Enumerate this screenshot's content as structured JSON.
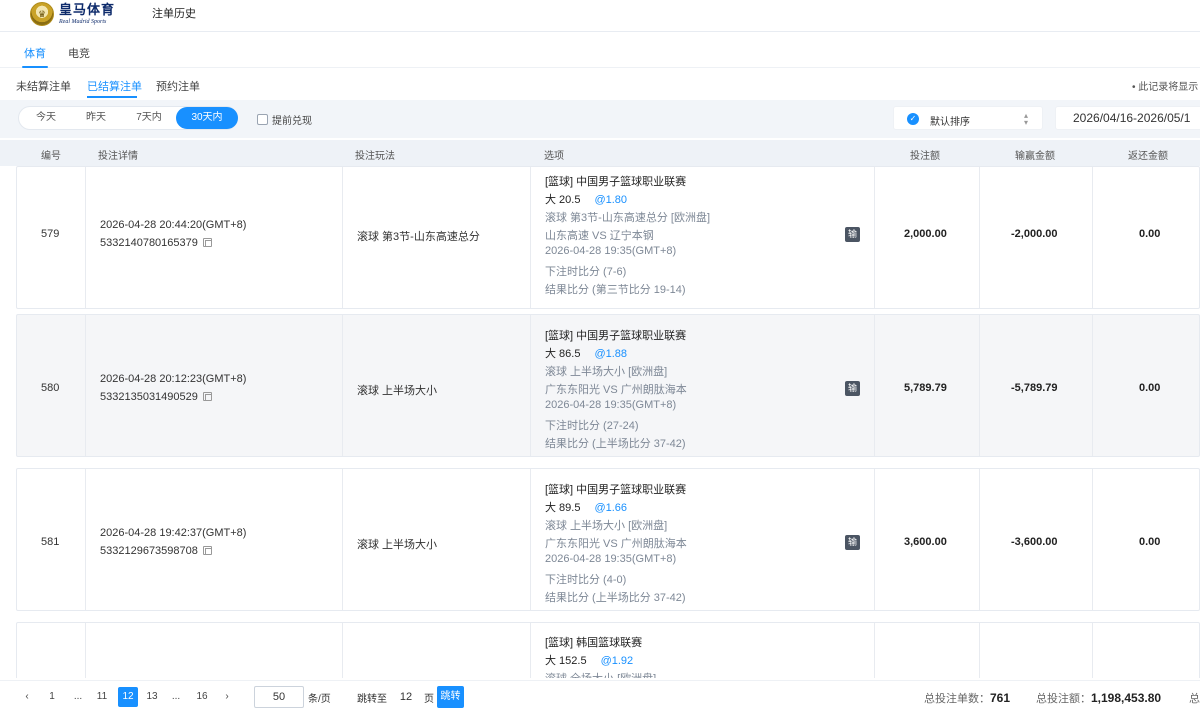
{
  "header": {
    "logo_cn": "皇马体育",
    "logo_en": "Real Madrid Sports",
    "page_title": "注单历史"
  },
  "top_tabs": [
    {
      "label": "体育",
      "active": true
    },
    {
      "label": "电竞",
      "active": false
    }
  ],
  "sub_tabs": [
    {
      "label": "未结算注单",
      "active": false
    },
    {
      "label": "已结算注单",
      "active": true
    },
    {
      "label": "预约注单",
      "active": false
    }
  ],
  "record_note": "• 此记录将显示",
  "filters": {
    "ranges": [
      {
        "label": "今天",
        "active": false
      },
      {
        "label": "昨天",
        "active": false
      },
      {
        "label": "7天内",
        "active": false
      },
      {
        "label": "30天内",
        "active": true
      }
    ],
    "early_cashout_label": "提前兑现",
    "early_cashout_checked": false,
    "sort_label": "默认排序",
    "date_range": "2026/04/16-2026/05/1"
  },
  "columns": [
    "编号",
    "投注详情",
    "投注玩法",
    "选项",
    "投注额",
    "输赢金额",
    "返还金额"
  ],
  "rows": [
    {
      "id": "579",
      "datetime": "2026-04-28 20:44:20(GMT+8)",
      "order_no": "5332140780165379",
      "play": "滚球   第3节-山东高速总分",
      "league": "[篮球] 中国男子篮球职业联赛",
      "pick": "大 20.5",
      "odds": "@1.80",
      "market": "滚球 第3节-山东高速总分 [欧洲盘]",
      "match": "山东高速 VS 辽宁本钢",
      "match_time": "2026-04-28 19:35(GMT+8)",
      "bet_score": "下注时比分 (7-6)",
      "result_score": "结果比分 (第三节比分 19-14)",
      "result_badge": "输",
      "stake": "2,000.00",
      "win_loss": "-2,000.00",
      "returned": "0.00"
    },
    {
      "id": "580",
      "datetime": "2026-04-28 20:12:23(GMT+8)",
      "order_no": "5332135031490529",
      "play": "滚球   上半场大小",
      "league": "[篮球] 中国男子篮球职业联赛",
      "pick": "大 86.5",
      "odds": "@1.88",
      "market": "滚球 上半场大小 [欧洲盘]",
      "match": "广东东阳光 VS 广州朗肽海本",
      "match_time": "2026-04-28 19:35(GMT+8)",
      "bet_score": "下注时比分 (27-24)",
      "result_score": "结果比分 (上半场比分 37-42)",
      "result_badge": "输",
      "stake": "5,789.79",
      "win_loss": "-5,789.79",
      "returned": "0.00"
    },
    {
      "id": "581",
      "datetime": "2026-04-28 19:42:37(GMT+8)",
      "order_no": "5332129673598708",
      "play": "滚球   上半场大小",
      "league": "[篮球] 中国男子篮球职业联赛",
      "pick": "大 89.5",
      "odds": "@1.66",
      "market": "滚球 上半场大小 [欧洲盘]",
      "match": "广东东阳光 VS 广州朗肽海本",
      "match_time": "2026-04-28 19:35(GMT+8)",
      "bet_score": "下注时比分 (4-0)",
      "result_score": "结果比分 (上半场比分 37-42)",
      "result_badge": "输",
      "stake": "3,600.00",
      "win_loss": "-3,600.00",
      "returned": "0.00"
    },
    {
      "id": "",
      "datetime": "",
      "order_no": "",
      "play": "",
      "league": "[篮球] 韩国篮球联赛",
      "pick": "大 152.5",
      "odds": "@1.92",
      "market": "滚球 全场大小 [欧洲盘]",
      "match": "",
      "match_time": "",
      "bet_score": "",
      "result_score": "",
      "result_badge": "",
      "stake": "",
      "win_loss": "",
      "returned": ""
    }
  ],
  "pagination": {
    "pages": [
      "1",
      "...",
      "11",
      "12",
      "13",
      "...",
      "16"
    ],
    "current": "12",
    "prev": "‹",
    "next": "›",
    "page_size": "50",
    "page_size_unit": "条/页",
    "jump_label": "跳转至",
    "jump_value": "12",
    "jump_unit": "页",
    "jump_button": "跳转"
  },
  "summary": {
    "count_label": "总投注单数：",
    "count_value": "761",
    "amount_label": "总投注额：",
    "amount_value": "1,198,453.80",
    "more_label": "总"
  }
}
